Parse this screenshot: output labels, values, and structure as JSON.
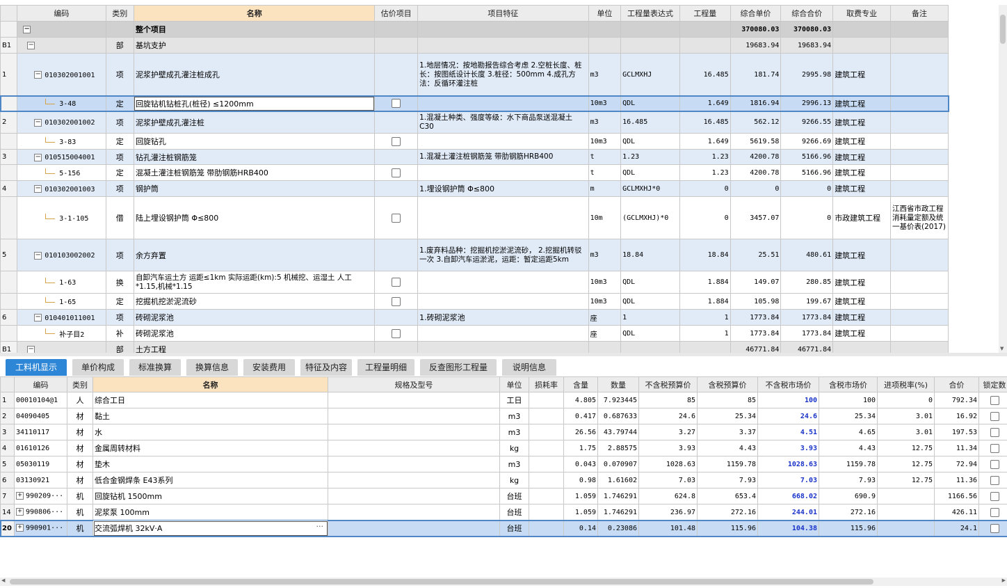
{
  "top_table": {
    "headers": [
      "编码",
      "类别",
      "名称",
      "估价项目",
      "项目特征",
      "单位",
      "工程量表达式",
      "工程量",
      "综合单价",
      "综合合价",
      "取费专业",
      "备注"
    ],
    "rows": [
      {
        "kind": "proj",
        "no": "",
        "code": "",
        "type": "",
        "name": "整个项目",
        "chk": false,
        "feature": "",
        "unit": "",
        "expr": "",
        "qty": "",
        "price": "370080.03",
        "total": "370080.03",
        "major": "",
        "note": ""
      },
      {
        "kind": "part",
        "no": "B1",
        "code": "",
        "type": "部",
        "name": "基坑支护",
        "chk": false,
        "feature": "",
        "unit": "",
        "expr": "",
        "qty": "",
        "price": "19683.94",
        "total": "19683.94",
        "major": "",
        "note": ""
      },
      {
        "kind": "qd",
        "no": "1",
        "code": "010302001001",
        "type": "项",
        "name": "泥浆护壁成孔灌注桩成孔",
        "chk": false,
        "feature": "1.地层情况：按地勘报告综合考虑\n2.空桩长度、桩长：按图纸设计长度\n3.桩径：500mm\n4.成孔方法：反循环灌注桩",
        "unit": "m3",
        "expr": "GCLMXHJ",
        "qty": "16.485",
        "price": "181.74",
        "total": "2995.98",
        "major": "建筑工程",
        "note": ""
      },
      {
        "kind": "sel",
        "no": "",
        "code": "3-48",
        "type": "定",
        "name": "回旋钻机钻桩孔(桩径) ≤1200mm",
        "chk": true,
        "feature": "",
        "unit": "10m3",
        "expr": "QDL",
        "qty": "1.649",
        "price": "1816.94",
        "total": "2996.13",
        "major": "建筑工程",
        "note": ""
      },
      {
        "kind": "qd",
        "no": "2",
        "code": "010302001002",
        "type": "项",
        "name": "泥浆护壁成孔灌注桩",
        "chk": false,
        "feature": "1.混凝土种类、强度等级：水下商品泵送混凝土 C30",
        "unit": "m3",
        "expr": "16.485",
        "qty": "16.485",
        "price": "562.12",
        "total": "9266.55",
        "major": "建筑工程",
        "note": ""
      },
      {
        "kind": "de",
        "no": "",
        "code": "3-83",
        "type": "定",
        "name": "回旋钻孔",
        "chk": true,
        "feature": "",
        "unit": "10m3",
        "expr": "QDL",
        "qty": "1.649",
        "price": "5619.58",
        "total": "9266.69",
        "major": "建筑工程",
        "note": ""
      },
      {
        "kind": "qd",
        "no": "3",
        "code": "010515004001",
        "type": "项",
        "name": "钻孔灌注桩钢筋笼",
        "chk": false,
        "feature": "1.混凝土灌注桩钢筋笼 带肋钢筋HRB400",
        "unit": "t",
        "expr": "1.23",
        "qty": "1.23",
        "price": "4200.78",
        "total": "5166.96",
        "major": "建筑工程",
        "note": ""
      },
      {
        "kind": "de",
        "no": "",
        "code": "5-156",
        "type": "定",
        "name": "混凝土灌注桩钢筋笼 带肋钢筋HRB400",
        "chk": true,
        "feature": "",
        "unit": "t",
        "expr": "QDL",
        "qty": "1.23",
        "price": "4200.78",
        "total": "5166.96",
        "major": "建筑工程",
        "note": ""
      },
      {
        "kind": "qd",
        "no": "4",
        "code": "010302001003",
        "type": "项",
        "name": "钢护筒",
        "chk": false,
        "feature": "1.埋设钢护筒 Φ≤800",
        "unit": "m",
        "expr": "GCLMXHJ*0",
        "qty": "0",
        "price": "0",
        "total": "0",
        "major": "建筑工程",
        "note": ""
      },
      {
        "kind": "de",
        "no": "",
        "code": "3-1-105",
        "type": "借",
        "name": "陆上埋设钢护筒 Φ≤800",
        "chk": true,
        "feature": "",
        "unit": "10m",
        "expr": "(GCLMXHJ)*0",
        "qty": "0",
        "price": "3457.07",
        "total": "0",
        "major": "市政建筑工程",
        "note": "江西省市政工程消耗量定额及统一基价表(2017)"
      },
      {
        "kind": "qd",
        "no": "5",
        "code": "010103002002",
        "type": "项",
        "name": "余方弃置",
        "chk": false,
        "feature": "1.废弃料品种：挖掘机挖淤泥流砂，\n2.挖掘机转驳一次\n3.自卸汽车运淤泥，运距：暂定运距5km",
        "unit": "m3",
        "expr": "18.84",
        "qty": "18.84",
        "price": "25.51",
        "total": "480.61",
        "major": "建筑工程",
        "note": ""
      },
      {
        "kind": "de",
        "no": "",
        "code": "1-63",
        "type": "换",
        "name": "自卸汽车运土方 运距≤1km  实际运距(km):5  机械挖、运湿土 人工*1.15,机械*1.15",
        "chk": true,
        "feature": "",
        "unit": "10m3",
        "expr": "QDL",
        "qty": "1.884",
        "price": "149.07",
        "total": "280.85",
        "major": "建筑工程",
        "note": ""
      },
      {
        "kind": "de",
        "no": "",
        "code": "1-65",
        "type": "定",
        "name": "挖掘机挖淤泥流砂",
        "chk": true,
        "feature": "",
        "unit": "10m3",
        "expr": "QDL",
        "qty": "1.884",
        "price": "105.98",
        "total": "199.67",
        "major": "建筑工程",
        "note": ""
      },
      {
        "kind": "qd",
        "no": "6",
        "code": "010401011001",
        "type": "项",
        "name": "砖砌泥浆池",
        "chk": false,
        "feature": "1.砖砌泥浆池",
        "unit": "座",
        "expr": "1",
        "qty": "1",
        "price": "1773.84",
        "total": "1773.84",
        "major": "建筑工程",
        "note": ""
      },
      {
        "kind": "de",
        "no": "",
        "code": "补子目2",
        "type": "补",
        "name": "砖砌泥浆池",
        "chk": true,
        "feature": "",
        "unit": "座",
        "expr": "QDL",
        "qty": "1",
        "price": "1773.84",
        "total": "1773.84",
        "major": "建筑工程",
        "note": ""
      },
      {
        "kind": "part",
        "no": "B1",
        "code": "",
        "type": "部",
        "name": "土方工程",
        "chk": false,
        "feature": "",
        "unit": "",
        "expr": "",
        "qty": "",
        "price": "46771.84",
        "total": "46771.84",
        "major": "",
        "note": ""
      }
    ]
  },
  "tabs": [
    "工料机显示",
    "单价构成",
    "标准换算",
    "换算信息",
    "安装费用",
    "特征及内容",
    "工程量明细",
    "反查图形工程量",
    "说明信息"
  ],
  "bottom_table": {
    "headers": [
      "编码",
      "类别",
      "名称",
      "规格及型号",
      "单位",
      "损耗率",
      "含量",
      "数量",
      "不含税预算价",
      "含税预算价",
      "不含税市场价",
      "含税市场价",
      "进项税率(%)",
      "合价",
      "锁定数"
    ],
    "rows": [
      {
        "no": "1",
        "code": "00010104@1",
        "expand": false,
        "type": "人",
        "name": "综合工日",
        "spec": "",
        "unit": "工日",
        "loss": "",
        "content": "4.805",
        "qty": "7.923445",
        "p1": "85",
        "p2": "85",
        "p3": "100",
        "p4": "100",
        "tax": "0",
        "total": "792.34"
      },
      {
        "no": "2",
        "code": "04090405",
        "expand": false,
        "type": "材",
        "name": "黏土",
        "spec": "",
        "unit": "m3",
        "loss": "",
        "content": "0.417",
        "qty": "0.687633",
        "p1": "24.6",
        "p2": "25.34",
        "p3": "24.6",
        "p4": "25.34",
        "tax": "3.01",
        "total": "16.92"
      },
      {
        "no": "3",
        "code": "34110117",
        "expand": false,
        "type": "材",
        "name": "水",
        "spec": "",
        "unit": "m3",
        "loss": "",
        "content": "26.56",
        "qty": "43.79744",
        "p1": "3.27",
        "p2": "3.37",
        "p3": "4.51",
        "p4": "4.65",
        "tax": "3.01",
        "total": "197.53"
      },
      {
        "no": "4",
        "code": "01610126",
        "expand": false,
        "type": "材",
        "name": "金属周转材料",
        "spec": "",
        "unit": "kg",
        "loss": "",
        "content": "1.75",
        "qty": "2.88575",
        "p1": "3.93",
        "p2": "4.43",
        "p3": "3.93",
        "p4": "4.43",
        "tax": "12.75",
        "total": "11.34"
      },
      {
        "no": "5",
        "code": "05030119",
        "expand": false,
        "type": "材",
        "name": "垫木",
        "spec": "",
        "unit": "m3",
        "loss": "",
        "content": "0.043",
        "qty": "0.070907",
        "p1": "1028.63",
        "p2": "1159.78",
        "p3": "1028.63",
        "p4": "1159.78",
        "tax": "12.75",
        "total": "72.94"
      },
      {
        "no": "6",
        "code": "03130921",
        "expand": false,
        "type": "材",
        "name": "低合金钢焊条 E43系列",
        "spec": "",
        "unit": "kg",
        "loss": "",
        "content": "0.98",
        "qty": "1.61602",
        "p1": "7.03",
        "p2": "7.93",
        "p3": "7.03",
        "p4": "7.93",
        "tax": "12.75",
        "total": "11.36"
      },
      {
        "no": "7",
        "code": "990209···",
        "expand": true,
        "type": "机",
        "name": "回旋钻机 1500mm",
        "spec": "",
        "unit": "台班",
        "loss": "",
        "content": "1.059",
        "qty": "1.746291",
        "p1": "624.8",
        "p2": "653.4",
        "p3": "668.02",
        "p4": "690.9",
        "tax": "",
        "total": "1166.56"
      },
      {
        "no": "14",
        "code": "990806···",
        "expand": true,
        "type": "机",
        "name": "泥浆泵 100mm",
        "spec": "",
        "unit": "台班",
        "loss": "",
        "content": "1.059",
        "qty": "1.746291",
        "p1": "236.97",
        "p2": "272.16",
        "p3": "244.01",
        "p4": "272.16",
        "tax": "",
        "total": "426.11"
      },
      {
        "no": "20",
        "code": "990901···",
        "expand": true,
        "type": "机",
        "name": "交流弧焊机 32kV·A",
        "spec": "",
        "unit": "台班",
        "loss": "",
        "content": "0.14",
        "qty": "0.23086",
        "p1": "101.48",
        "p2": "115.96",
        "p3": "104.38",
        "p4": "115.96",
        "tax": "",
        "total": "24.1"
      }
    ],
    "blue_col": "p3",
    "name_dots": "···"
  },
  "colors": {
    "accent": "#2e86d6",
    "selected_row": "#c7dcf4",
    "qd_row": "#e1ebf8",
    "header_highlight": "#fce3c0",
    "market_price": "#1a33c8"
  }
}
